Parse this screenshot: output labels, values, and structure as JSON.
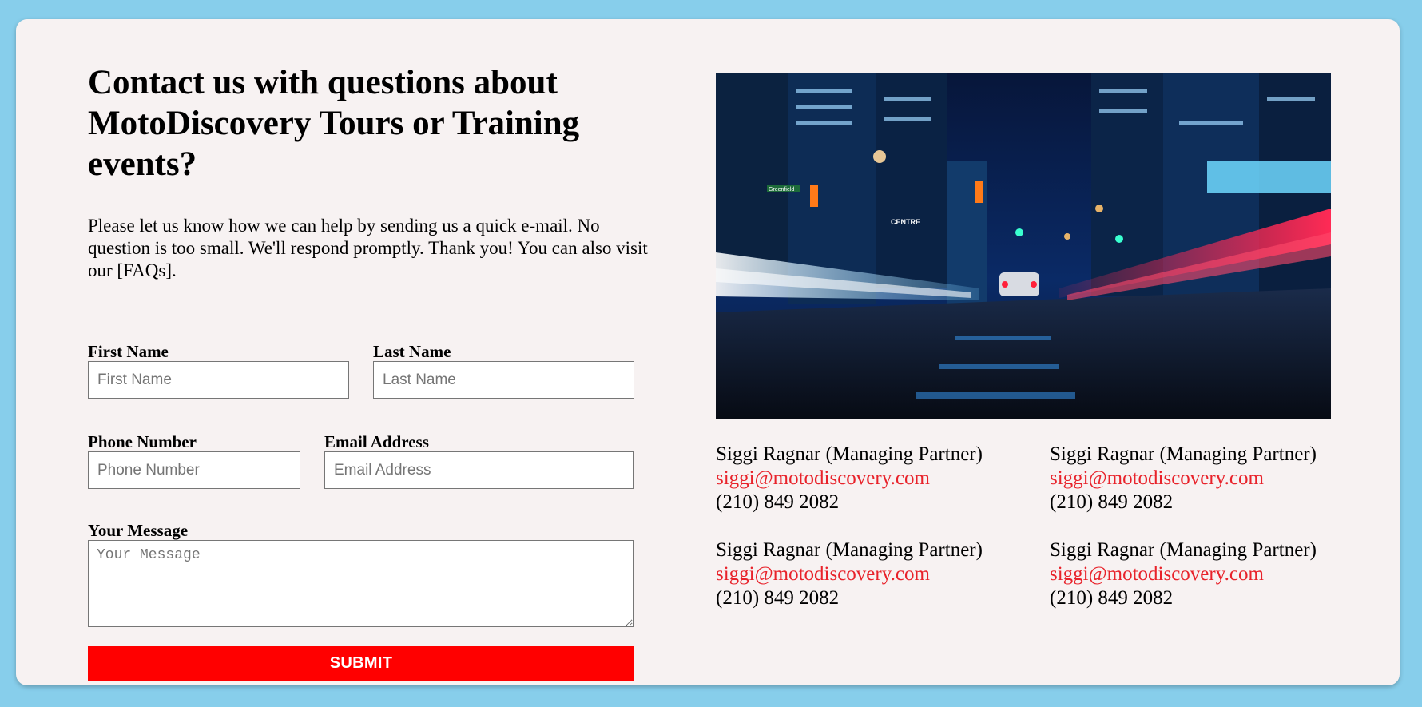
{
  "heading": "Contact us with questions about MotoDiscovery Tours or Training events?",
  "intro": "Please let us know how we can help by sending us a quick e-mail. No question is too small. We'll respond promptly. Thank you! You can also visit our [FAQs].",
  "form": {
    "first_name": {
      "label": "First Name",
      "placeholder": "First Name",
      "value": ""
    },
    "last_name": {
      "label": "Last Name",
      "placeholder": "Last Name",
      "value": ""
    },
    "phone": {
      "label": "Phone Number",
      "placeholder": "Phone Number",
      "value": ""
    },
    "email": {
      "label": "Email Address",
      "placeholder": "Email Address",
      "value": ""
    },
    "message": {
      "label": "Your Message",
      "placeholder": "Your Message",
      "value": ""
    },
    "submit_label": "SUBMIT"
  },
  "contacts": [
    {
      "name": "Siggi Ragnar (Managing Partner)",
      "email": "siggi@motodiscovery.com",
      "phone": "(210) 849 2082"
    },
    {
      "name": "Siggi Ragnar (Managing Partner)",
      "email": "siggi@motodiscovery.com",
      "phone": "(210) 849 2082"
    },
    {
      "name": "Siggi Ragnar (Managing Partner)",
      "email": "siggi@motodiscovery.com",
      "phone": "(210) 849 2082"
    },
    {
      "name": "Siggi Ragnar (Managing Partner)",
      "email": "siggi@motodiscovery.com",
      "phone": "(210) 849 2082"
    }
  ],
  "photo": {
    "sign_text": "Greenfield",
    "building_sign": "CENTRE"
  },
  "colors": {
    "page_background": "#87ceeb",
    "card_background": "#f7f2f2",
    "accent": "#ff0000",
    "link": "#e8222a"
  }
}
